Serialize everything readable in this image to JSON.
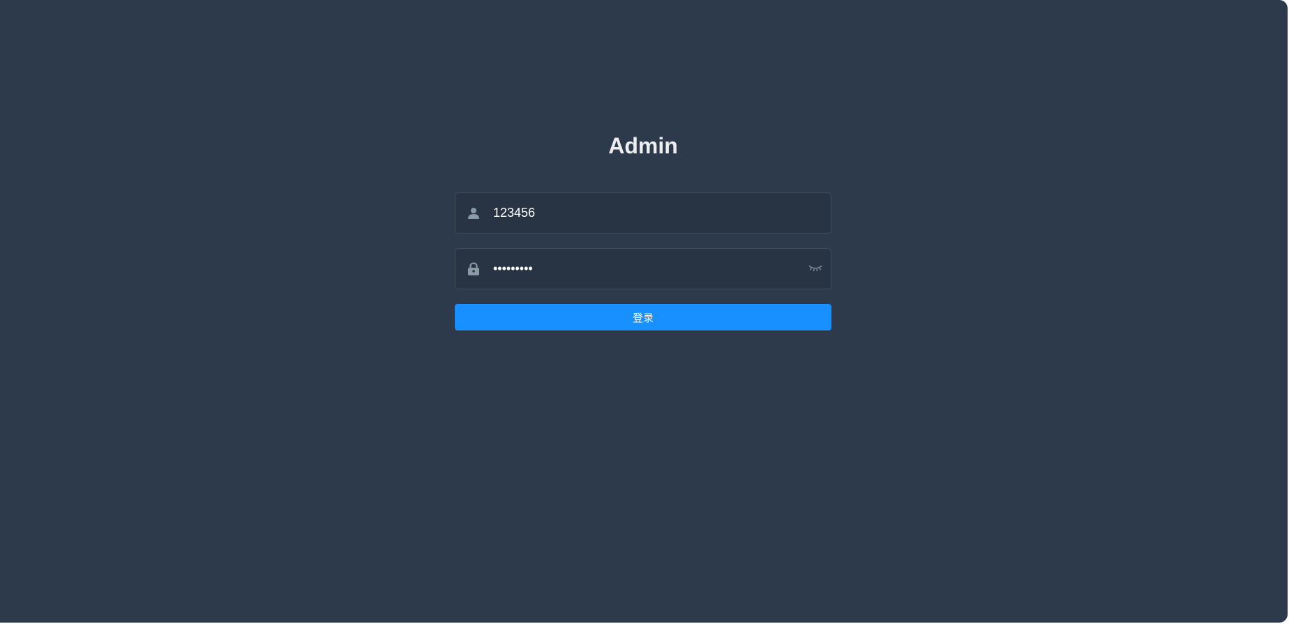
{
  "login": {
    "title": "Admin",
    "username": {
      "value": "123456",
      "icon": "user-icon"
    },
    "password": {
      "masked_value": "•••••••••",
      "icon": "lock-icon",
      "toggle_icon": "eye-closed-icon"
    },
    "submit_label": "登录"
  },
  "colors": {
    "background": "#2d3a4b",
    "input_background": "#283443",
    "primary": "#1890ff",
    "title": "#eeeeee",
    "icon": "#889aa4"
  }
}
